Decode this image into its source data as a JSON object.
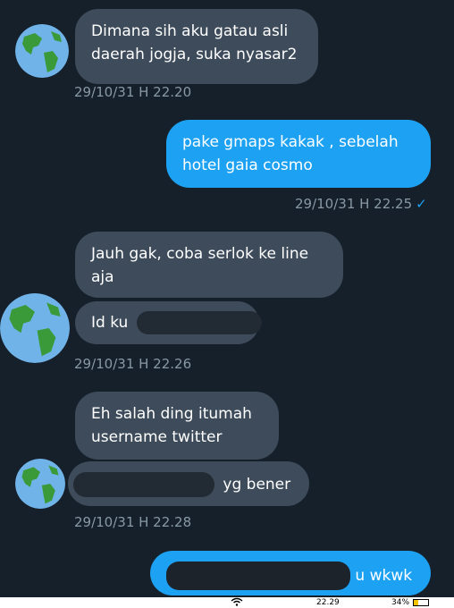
{
  "messages": {
    "m1": {
      "text": "Dimana sih aku gatau asli daerah jogja, suka nyasar2"
    },
    "m1_line1": "Dimana sih aku gatau asli",
    "m1_line2": "daerah jogja, suka nyasar2",
    "ts1": "29/10/31 H 22.20",
    "m2_line1": "pake gmaps kakak , sebelah",
    "m2_line2": "hotel gaia cosmo",
    "ts2": "29/10/31 H 22.25",
    "check": "✓",
    "m3_line1": "Jauh gak, coba serlok ke line",
    "m3_line2": "aja",
    "m4": "Id ku",
    "ts3": "29/10/31 H 22.26",
    "m5_line1": "Eh salah ding itumah",
    "m5_line2": "username twitter",
    "m6": "yg bener",
    "ts4": "29/10/31 H 22.28",
    "m7": "u wkwk"
  },
  "status_bar": {
    "time": "22.29",
    "battery": "34%"
  },
  "colors": {
    "background": "#16202a",
    "incoming_bubble": "#3d4b5a",
    "outgoing_bubble": "#1da1f2",
    "timestamp": "#8899a6",
    "redaction": "#222a33"
  },
  "icons": {
    "avatar": "earth-globe-icon",
    "read_receipt": "check-icon"
  }
}
